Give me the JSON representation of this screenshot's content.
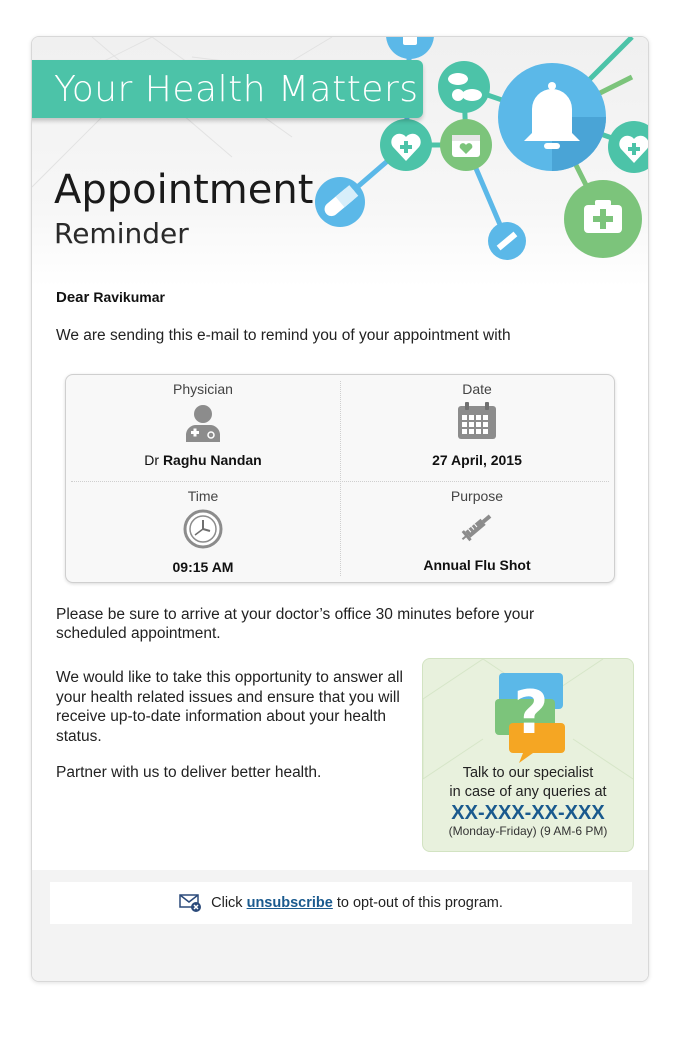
{
  "header": {
    "banner": "Your Health Matters",
    "title": "Appointment",
    "subtitle": "Reminder"
  },
  "greeting": {
    "dear": "Dear",
    "name": "Ravikumar"
  },
  "intro": "We are sending this e-mail to remind you of your appointment with",
  "appointment": {
    "physician": {
      "label": "Physician",
      "prefix": "Dr",
      "name": "Raghu Nandan"
    },
    "date": {
      "label": "Date",
      "value": "27 April, 2015"
    },
    "time": {
      "label": "Time",
      "value": "09:15 AM"
    },
    "purpose": {
      "label": "Purpose",
      "value": "Annual Flu Shot"
    }
  },
  "arrive_note": "Please be sure to arrive at your doctor’s office 30 minutes before your scheduled appointment.",
  "opportunity": "We would like to take this opportunity to answer all your health related issues and ensure that you will receive up-to-date information about your health status.",
  "partner": "Partner with us to deliver better health.",
  "specialist": {
    "line1": "Talk to our specialist",
    "line2": "in case of any queries at",
    "phone": "XX-XXX-XX-XXX",
    "hours": "(Monday-Friday) (9 AM-6 PM)"
  },
  "footer": {
    "prefix": "Click",
    "link": "unsubscribe",
    "suffix": "to opt-out of this program."
  },
  "colors": {
    "teal": "#4cc3a8",
    "blue": "#5bb8e8",
    "green": "#7cc47b",
    "phone": "#1a5a8e"
  },
  "icons": [
    "bell-icon",
    "pills-icon",
    "heart-icon",
    "calendar-icon",
    "first-aid-icon",
    "capsule-icon",
    "syringe-icon",
    "doctor-icon",
    "clock-icon",
    "question-bubble-icon",
    "mail-unsubscribe-icon"
  ]
}
